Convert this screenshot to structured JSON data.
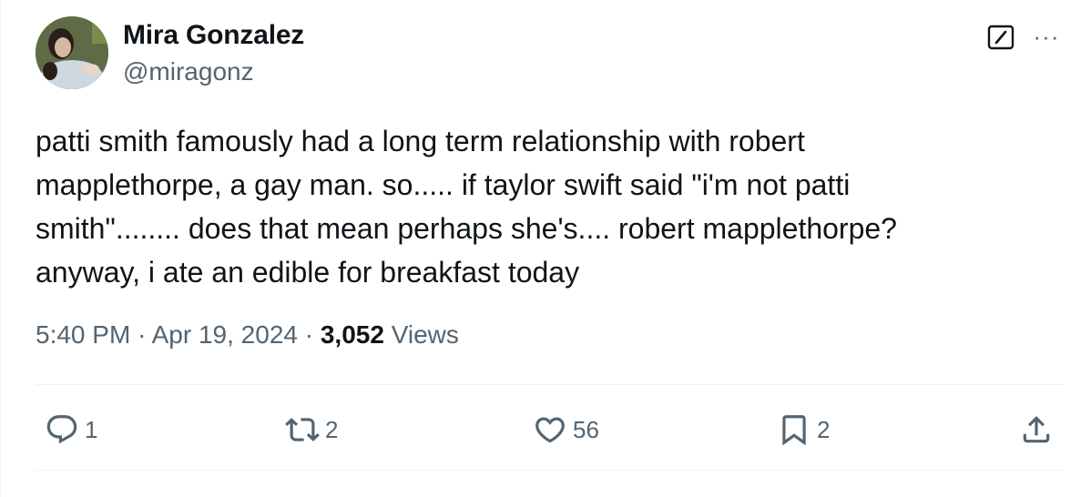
{
  "author": {
    "name": "Mira Gonzalez",
    "handle": "@miragonz"
  },
  "tweet": {
    "text": "patti smith famously had a long term relationship with robert\nmapplethorpe, a gay man. so..... if taylor swift said \"i'm not patti\nsmith\"........ does that mean perhaps she's.... robert mapplethorpe?\nanyway, i ate an edible for breakfast today"
  },
  "meta": {
    "time": "5:40 PM",
    "date": "Apr 19, 2024",
    "separator": "·",
    "views_count": "3,052",
    "views_label": "Views"
  },
  "actions": {
    "reply_count": "1",
    "retweet_count": "2",
    "like_count": "56",
    "bookmark_count": "2"
  },
  "header": {
    "more_label": "···"
  },
  "colors": {
    "text": "#0f1419",
    "muted": "#536471",
    "divider": "#eff3f4"
  },
  "icons": [
    "grok-icon",
    "more-icon",
    "reply-icon",
    "retweet-icon",
    "like-icon",
    "bookmark-icon",
    "share-icon"
  ]
}
